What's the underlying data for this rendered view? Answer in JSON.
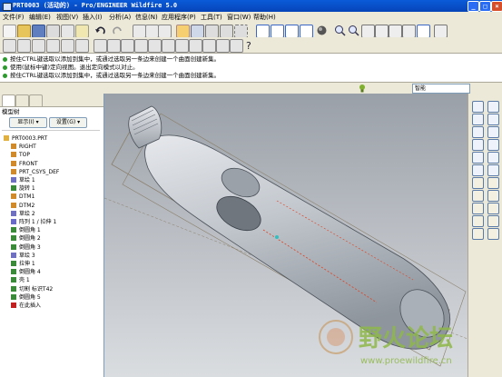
{
  "window": {
    "title": "PRT0003 (活动的) - Pro/ENGINEER Wildfire 5.0"
  },
  "menubar": {
    "items": [
      "文件(F)",
      "编辑(E)",
      "视图(V)",
      "插入(I)",
      "分析(A)",
      "信息(N)",
      "应用程序(P)",
      "工具(T)",
      "窗口(W)",
      "帮助(H)"
    ]
  },
  "messages": [
    "按住CTRL键选取以添加到集中，或通过选取另一条边来创建一个曲面创建新集。",
    "使用(鼠标中键)定向视图。退出定向模式以对止。",
    "按住CTRL键选取以添加到集中，或通过选取另一条边来创建一个曲面创建新集。"
  ],
  "statusbar": {
    "filter_value": "智能"
  },
  "left_panel": {
    "header": "模型树",
    "display_label": "显示(I) ▾",
    "settings_label": "设置(G) ▾",
    "tree": [
      {
        "label": "PRT0003.PRT",
        "indent": 0,
        "icon": "part-icon"
      },
      {
        "label": "RIGHT",
        "indent": 1,
        "icon": "datum-plane-icon"
      },
      {
        "label": "TOP",
        "indent": 1,
        "icon": "datum-plane-icon"
      },
      {
        "label": "FRONT",
        "indent": 1,
        "icon": "datum-plane-icon"
      },
      {
        "label": "PRT_CSYS_DEF",
        "indent": 1,
        "icon": "csys-icon"
      },
      {
        "label": "草绘 1",
        "indent": 1,
        "icon": "sketch-icon"
      },
      {
        "label": "旋转 1",
        "indent": 1,
        "icon": "revolve-icon"
      },
      {
        "label": "DTM1",
        "indent": 1,
        "icon": "datum-plane-icon"
      },
      {
        "label": "DTM2",
        "indent": 1,
        "icon": "datum-plane-icon"
      },
      {
        "label": "草绘 2",
        "indent": 1,
        "icon": "sketch-icon"
      },
      {
        "label": "阵列 1 / 拉伸 1",
        "indent": 1,
        "icon": "pattern-icon"
      },
      {
        "label": "倒圆角 1",
        "indent": 1,
        "icon": "round-icon"
      },
      {
        "label": "倒圆角 2",
        "indent": 1,
        "icon": "round-icon"
      },
      {
        "label": "倒圆角 3",
        "indent": 1,
        "icon": "round-icon"
      },
      {
        "label": "草绘 3",
        "indent": 1,
        "icon": "sketch-icon"
      },
      {
        "label": "拉伸 1",
        "indent": 1,
        "icon": "extrude-icon"
      },
      {
        "label": "倒圆角 4",
        "indent": 1,
        "icon": "round-icon"
      },
      {
        "label": "壳 1",
        "indent": 1,
        "icon": "shell-icon"
      },
      {
        "label": "切割 标识T42",
        "indent": 1,
        "icon": "cut-icon"
      },
      {
        "label": "倒圆角 5",
        "indent": 1,
        "icon": "round-icon"
      },
      {
        "label": "在此插入",
        "indent": 1,
        "icon": "insert-here-icon"
      }
    ]
  },
  "watermark": {
    "text": "野火论坛",
    "url": "www.proewildfire.cn"
  },
  "colors": {
    "titlebar": "#0a5bd9",
    "model_surface": "#c8ccd2",
    "highlight": "#e04020",
    "watermark": "#8fb84a"
  }
}
